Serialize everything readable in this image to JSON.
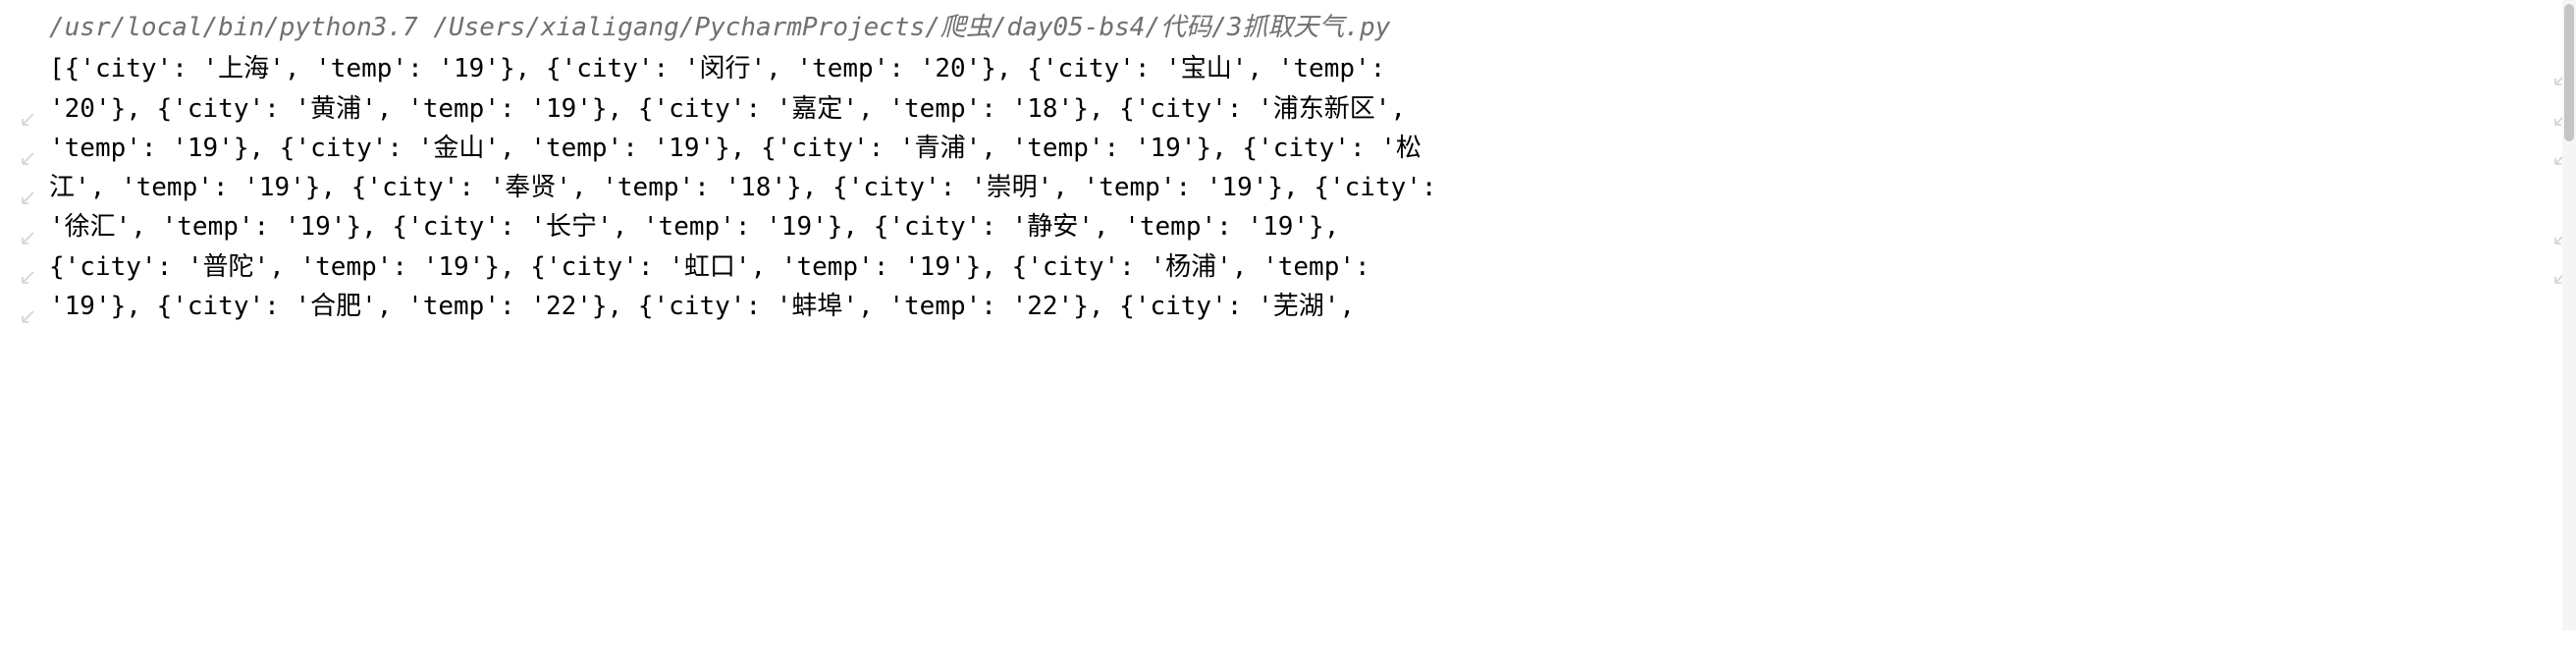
{
  "command": "/usr/local/bin/python3.7 /Users/xialigang/PycharmProjects/爬虫/day05-bs4/代码/3抓取天气.py",
  "output_lines": [
    "[{'city': '上海', 'temp': '19'}, {'city': '闵行', 'temp': '20'}, {'city': '宝山', 'temp': ",
    "'20'}, {'city': '黄浦', 'temp': '19'}, {'city': '嘉定', 'temp': '18'}, {'city': '浦东新区', ",
    "'temp': '19'}, {'city': '金山', 'temp': '19'}, {'city': '青浦', 'temp': '19'}, {'city': '松",
    "江', 'temp': '19'}, {'city': '奉贤', 'temp': '18'}, {'city': '崇明', 'temp': '19'}, {'city':",
    " '徐汇', 'temp': '19'}, {'city': '长宁', 'temp': '19'}, {'city': '静安', 'temp': '19'}, ",
    "{'city': '普陀', 'temp': '19'}, {'city': '虹口', 'temp': '19'}, {'city': '杨浦', 'temp': ",
    "'19'}, {'city': '合肥', 'temp': '22'}, {'city': '蚌埠', 'temp': '22'}, {'city': '芜湖', "
  ],
  "line_wrap_left": [
    false,
    true,
    true,
    true,
    true,
    true,
    true
  ],
  "line_wrap_right": [
    true,
    true,
    true,
    false,
    true,
    true,
    false
  ]
}
